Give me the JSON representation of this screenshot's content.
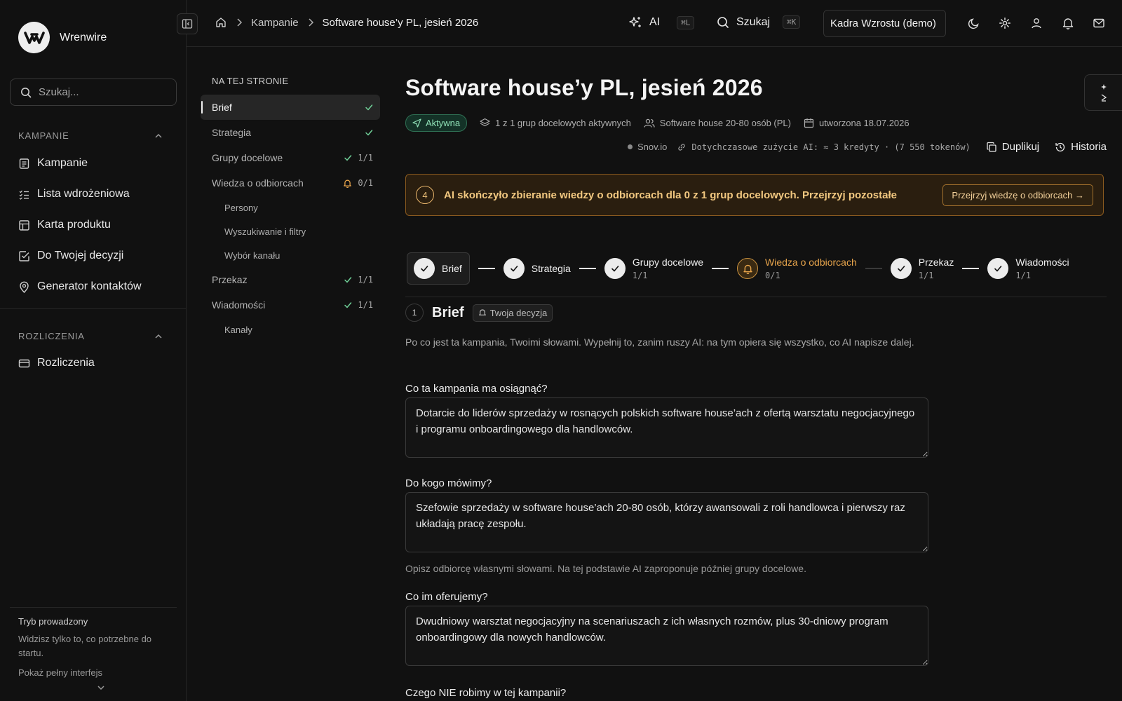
{
  "sidebar": {
    "brand": "Wrenwire",
    "search_placeholder": "Szukaj...",
    "sections": [
      {
        "title": "KAMPANIE",
        "items": [
          "Kampanie",
          "Lista wdrożeniowa",
          "Karta produktu",
          "Do Twojej decyzji",
          "Generator kontaktów"
        ]
      },
      {
        "title": "ROZLICZENIA",
        "items": [
          "Rozliczenia"
        ]
      }
    ],
    "guided": {
      "title": "Tryb prowadzony",
      "desc": "Widzisz tylko to, co potrzebne do startu.",
      "link": "Pokaż pełny interfejs"
    }
  },
  "topbar": {
    "breadcrumbs": [
      "Kampanie",
      "Software house’y PL, jesień 2026"
    ],
    "ai_label": "AI",
    "ai_kbd": "⌘L",
    "search_label": "Szukaj",
    "search_kbd": "⌘K",
    "org": "Kadra Wzrostu (demo)"
  },
  "toc": {
    "title": "NA TEJ STRONIE",
    "items": [
      {
        "label": "Brief",
        "status": "",
        "state": "ok"
      },
      {
        "label": "Strategia",
        "status": "",
        "state": "ok"
      },
      {
        "label": "Grupy docelowe",
        "status": "1/1",
        "state": "ok"
      },
      {
        "label": "Wiedza o odbiorcach",
        "status": "0/1",
        "state": "warn"
      },
      {
        "label": "Persony",
        "status": "",
        "state": "none",
        "sub": true
      },
      {
        "label": "Wyszukiwanie i filtry",
        "status": "",
        "state": "none",
        "sub": true
      },
      {
        "label": "Wybór kanału",
        "status": "",
        "state": "none",
        "sub": true
      },
      {
        "label": "Przekaz",
        "status": "1/1",
        "state": "ok"
      },
      {
        "label": "Wiadomości",
        "status": "1/1",
        "state": "ok"
      },
      {
        "label": "Kanały",
        "status": "",
        "state": "none",
        "sub": true
      }
    ]
  },
  "campaign": {
    "title": "Software house’y PL, jesień 2026",
    "status": "Aktywna",
    "groups": "1 z 1 grup docelowych aktywnych",
    "segment": "Software house 20-80 osób (PL)",
    "created": "utworzona 18.07.2026",
    "provider": "Snov.io",
    "usage": "Dotychczasowe zużycie AI: ≈ 3 kredyty · (7 550 tokenów)",
    "duplicate": "Duplikuj",
    "history": "Historia"
  },
  "alert": {
    "num": "4",
    "text": "AI skończyło zbieranie wiedzy o odbiorcach dla 0 z 1 grup docelowych. Przejrzyj pozostałe",
    "button": "Przejrzyj wiedzę o odbiorcach →"
  },
  "stepper": [
    {
      "label": "Brief",
      "count": "",
      "state": "done"
    },
    {
      "label": "Strategia",
      "count": "",
      "state": "done"
    },
    {
      "label": "Grupy docelowe",
      "count": "1/1",
      "state": "done"
    },
    {
      "label": "Wiedza o odbiorcach",
      "count": "0/1",
      "state": "warn"
    },
    {
      "label": "Przekaz",
      "count": "1/1",
      "state": "done"
    },
    {
      "label": "Wiadomości",
      "count": "1/1",
      "state": "done"
    }
  ],
  "brief": {
    "num": "1",
    "title": "Brief",
    "badge": "Twoja decyzja",
    "intro": "Po co jest ta kampania, Twoimi słowami. Wypełnij to, zanim ruszy AI: na tym opiera się wszystko, co AI napisze dalej.",
    "q1": "Co ta kampania ma osiągnąć?",
    "a1": "Dotarcie do liderów sprzedaży w rosnących polskich software house’ach z ofertą warsztatu negocjacyjnego i programu onboardingowego dla handlowców.",
    "q2": "Do kogo mówimy?",
    "a2": "Szefowie sprzedaży w software house’ach 20-80 osób, którzy awansowali z roli handlowca i pierwszy raz układają pracę zespołu.",
    "h2": "Opisz odbiorcę własnymi słowami. Na tej podstawie AI zaproponuje później grupy docelowe.",
    "q3": "Co im oferujemy?",
    "a3": "Dwudniowy warsztat negocjacyjny na scenariuszach z ich własnych rozmów, plus 30-dniowy program onboardingowy dla nowych handlowców.",
    "q4": "Czego NIE robimy w tej kampanii?"
  }
}
